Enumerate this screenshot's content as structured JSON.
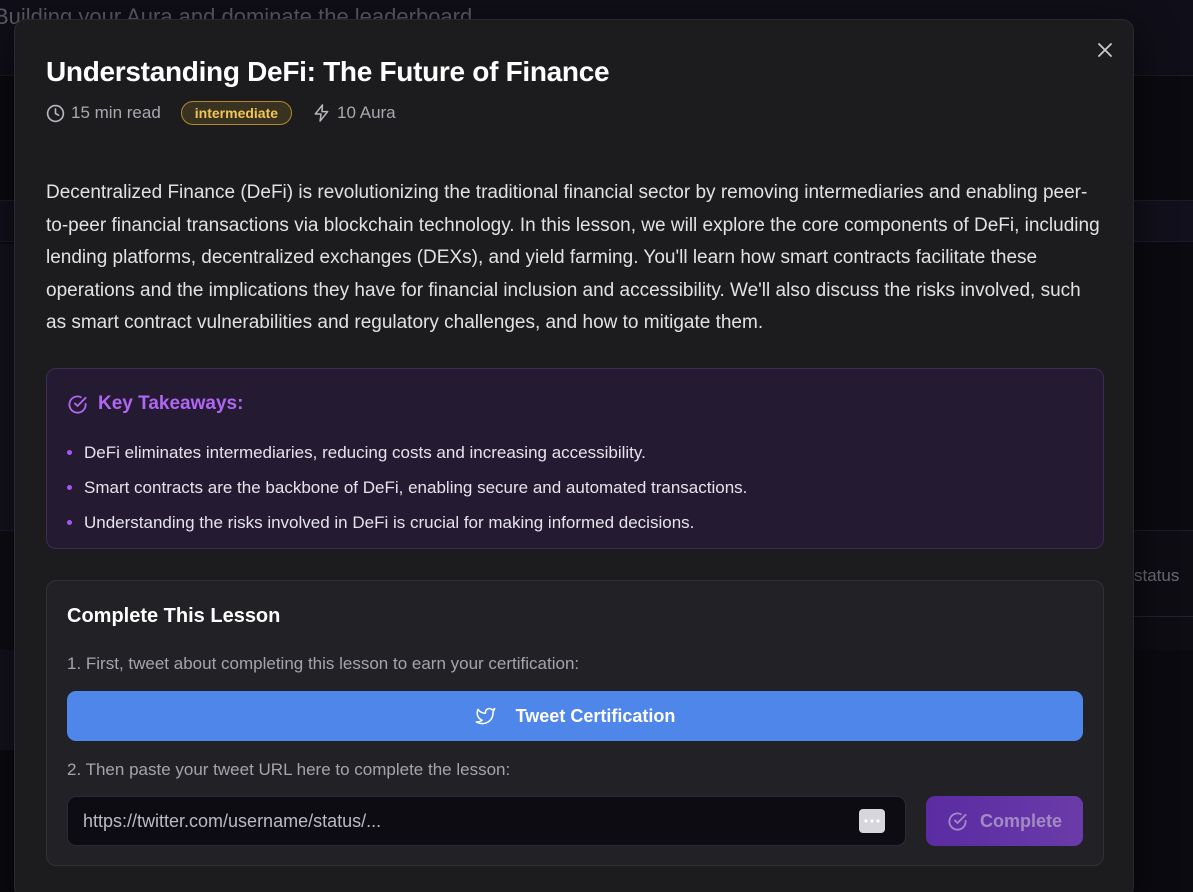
{
  "background": {
    "header_text": "Building your Aura and dominate the leaderboard",
    "status_text": "status"
  },
  "modal": {
    "title": "Understanding DeFi: The Future of Finance",
    "meta": {
      "read_time": "15 min read",
      "level": "intermediate",
      "reward": "10 Aura"
    },
    "description": "Decentralized Finance (DeFi) is revolutionizing the traditional financial sector by removing intermediaries and enabling peer-to-peer financial transactions via blockchain technology. In this lesson, we will explore the core components of DeFi, including lending platforms, decentralized exchanges (DEXs), and yield farming. You'll learn how smart contracts facilitate these operations and the implications they have for financial inclusion and accessibility. We'll also discuss the risks involved, such as smart contract vulnerabilities and regulatory challenges, and how to mitigate them.",
    "takeaways": {
      "heading": "Key Takeaways:",
      "items": [
        "DeFi eliminates intermediaries, reducing costs and increasing accessibility.",
        "Smart contracts are the backbone of DeFi, enabling secure and automated transactions.",
        "Understanding the risks involved in DeFi is crucial for making informed decisions."
      ]
    },
    "complete": {
      "heading": "Complete This Lesson",
      "step1": "1. First, tweet about completing this lesson to earn your certification:",
      "tweet_button": "Tweet Certification",
      "step2": "2. Then paste your tweet URL here to complete the lesson:",
      "url_placeholder": "https://twitter.com/username/status/...",
      "url_value": "",
      "complete_button": "Complete"
    }
  },
  "colors": {
    "accent_purple": "#a855f7",
    "tweet_blue": "#4f86ea",
    "badge_gold": "#f0c653"
  },
  "icons": [
    "close-icon",
    "clock-icon",
    "bolt-icon",
    "check-circle-icon",
    "twitter-icon",
    "password-manager-icon"
  ]
}
